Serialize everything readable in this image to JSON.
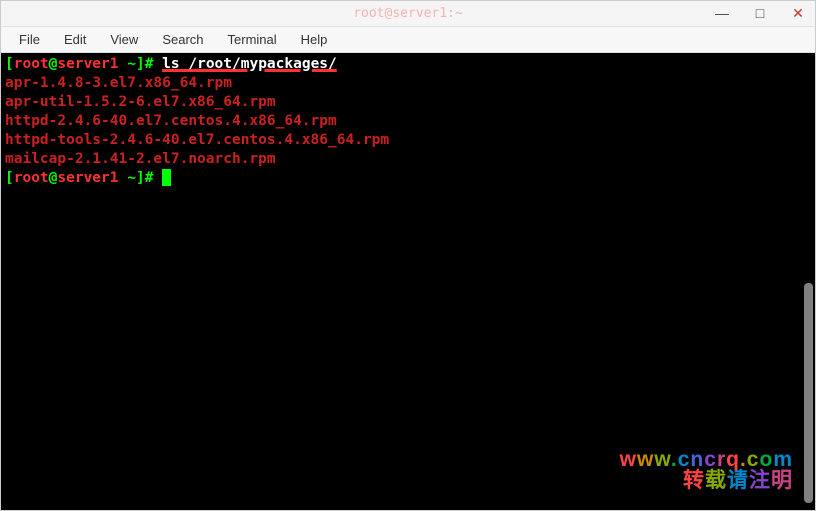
{
  "window": {
    "title": "root@server1:~"
  },
  "menu": {
    "file": "File",
    "edit": "Edit",
    "view": "View",
    "search": "Search",
    "terminal": "Terminal",
    "help": "Help"
  },
  "prompt": {
    "user": "root",
    "at": "@",
    "host": "server1",
    "path": " ~",
    "open_bracket": "[",
    "close_bracket": "]",
    "hash": "# "
  },
  "command": {
    "ls": "ls /root/mypackages/"
  },
  "files": {
    "f0": "apr-1.4.8-3.el7.x86_64.rpm",
    "f1": "apr-util-1.5.2-6.el7.x86_64.rpm",
    "f2": "httpd-2.4.6-40.el7.centos.4.x86_64.rpm",
    "f3": "httpd-tools-2.4.6-40.el7.centos.4.x86_64.rpm",
    "f4": "mailcap-2.1.41-2.el7.noarch.rpm"
  },
  "watermark": {
    "url_chars": {
      "c0": "w",
      "c1": "w",
      "c2": "w",
      "c3": ".",
      "c4": "c",
      "c5": "n",
      "c6": "c",
      "c7": "r",
      "c8": "q",
      "c9": ".",
      "c10": "c",
      "c11": "o",
      "c12": "m"
    },
    "sub_chars": {
      "c0": "转",
      "c1": "载",
      "c2": "请",
      "c3": "注",
      "c4": "明"
    }
  }
}
